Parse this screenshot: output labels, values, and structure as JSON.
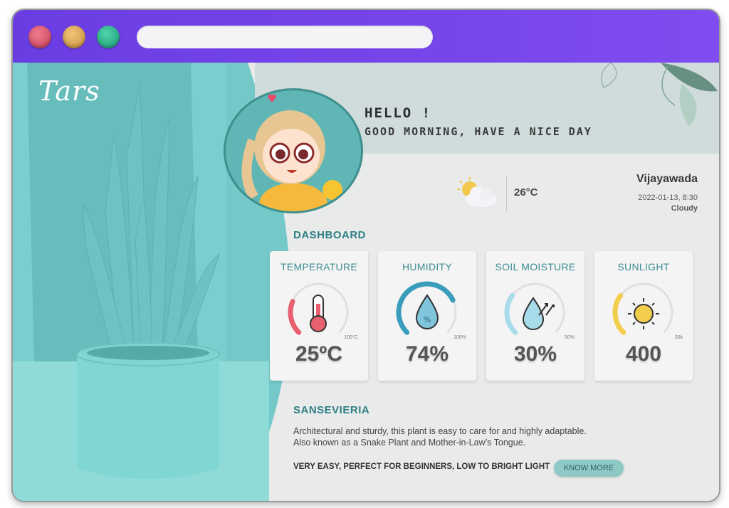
{
  "window": {
    "traffic_lights": [
      "close",
      "minimize",
      "maximize"
    ],
    "accent": "#6a3de3"
  },
  "brand": {
    "logo_text": "Tars"
  },
  "greeting": {
    "title": "HELLO !",
    "subtitle": "GOOD MORNING, HAVE A NICE DAY"
  },
  "weather": {
    "icon": "partly-cloudy-icon",
    "temperature": "26°C",
    "city": "Vijayawada",
    "datetime": "2022-01-13, 8:30",
    "condition": "Cloudy"
  },
  "dashboard": {
    "heading": "DASHBOARD",
    "cards": [
      {
        "title": "TEMPERATURE",
        "value": "25ºC",
        "max_label": "100°C",
        "fraction": 0.25,
        "color": "#e8606f",
        "icon": "thermometer-icon"
      },
      {
        "title": "HUMIDITY",
        "value": "74%",
        "max_label": "100%",
        "fraction": 0.74,
        "color": "#3a9dbb",
        "icon": "water-drop-percent-icon"
      },
      {
        "title": "SOIL MOISTURE",
        "value": "30%",
        "max_label": "50%",
        "fraction": 0.3,
        "color": "#a9dcea",
        "icon": "soil-moisture-icon"
      },
      {
        "title": "SUNLIGHT",
        "value": "400",
        "max_label": "30k",
        "fraction": 0.3,
        "color": "#f2cd4e",
        "icon": "sun-icon"
      }
    ]
  },
  "plant": {
    "name": "SANSEVIERIA",
    "description_line1": "Architectural and sturdy, this plant is easy to care for and highly adaptable.",
    "description_line2": "Also known as a Snake Plant and Mother-in-Law’s Tongue.",
    "tags": "VERY EASY, PERFECT FOR BEGINNERS, LOW TO BRIGHT LIGHT",
    "button_label": "KNOW MORE"
  }
}
